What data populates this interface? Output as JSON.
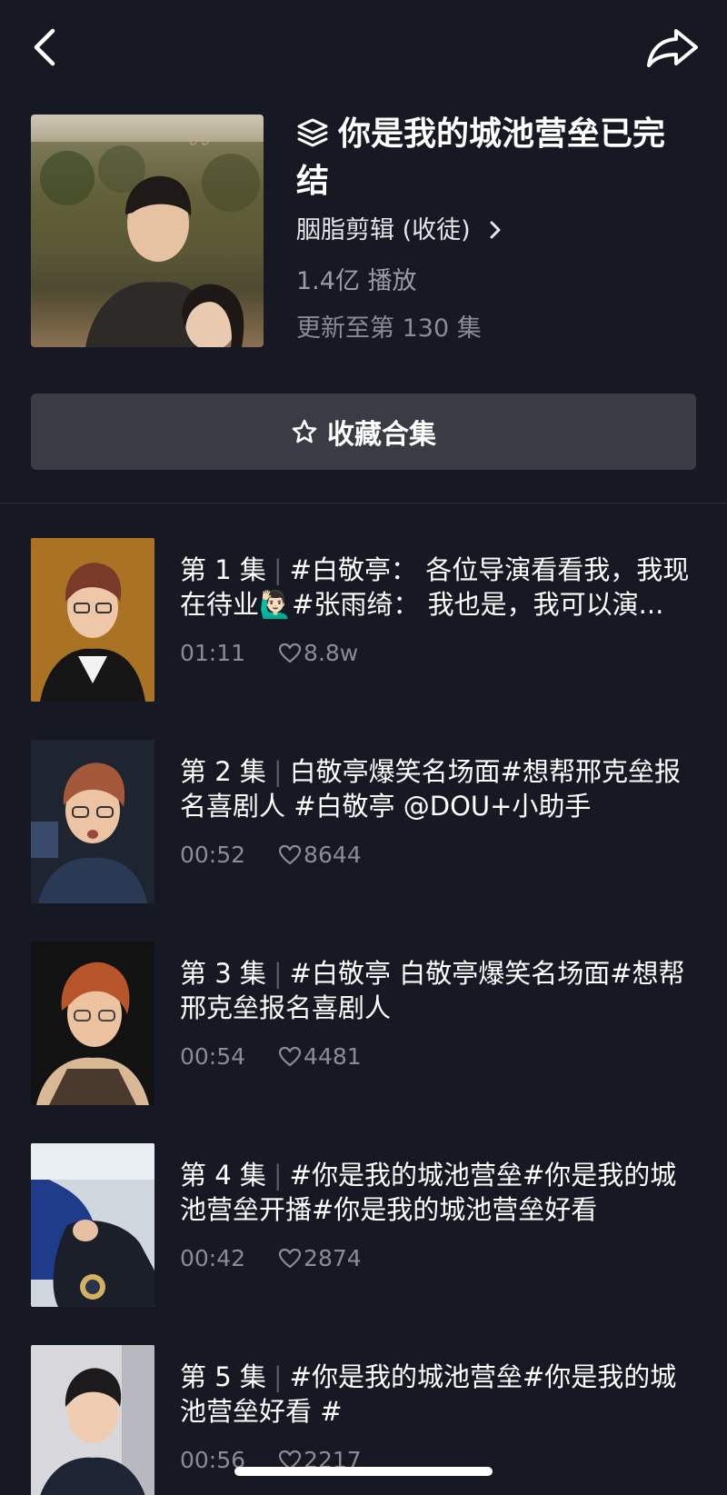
{
  "nav": {
    "back_icon": "chevron-left-icon",
    "share_icon": "share-arrow-icon"
  },
  "collection": {
    "title": "你是我的城池营垒已完结",
    "title_icon": "layers-icon",
    "author": "胭脂剪辑 (收徒)",
    "plays": "1.4亿 播放",
    "update_status": "更新至第 130 集",
    "favorite_label": "收藏合集",
    "favorite_icon": "star-outline-icon"
  },
  "episodes": [
    {
      "label": "第 1 集",
      "text": "#白敬亭： 各位导演看看我，我现在待业🙋🏻‍♂️#张雨绮： 我也是，我可以演...",
      "duration": "01:11",
      "likes": "8.8w"
    },
    {
      "label": "第 2 集",
      "text": "白敬亭爆笑名场面#想帮邢克垒报名喜剧人 #白敬亭 @DOU+小助手",
      "duration": "00:52",
      "likes": "8644"
    },
    {
      "label": "第 3 集",
      "text": "#白敬亭 白敬亭爆笑名场面#想帮邢克垒报名喜剧人",
      "duration": "00:54",
      "likes": "4481"
    },
    {
      "label": "第 4 集",
      "text": "#你是我的城池营垒#你是我的城池营垒开播#你是我的城池营垒好看",
      "duration": "00:42",
      "likes": "2874"
    },
    {
      "label": "第 5 集",
      "text": "#你是我的城池营垒#你是我的城池营垒好看 #",
      "duration": "00:56",
      "likes": "2217"
    }
  ],
  "colors": {
    "background": "#161823",
    "button_bg": "#393b45",
    "secondary_text": "#8a8b94"
  }
}
